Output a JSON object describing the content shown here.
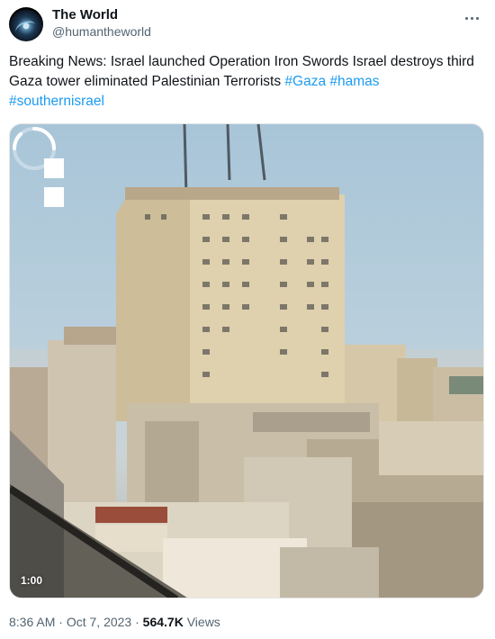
{
  "author": {
    "display_name": "The World",
    "handle": "@humantheworld",
    "avatar_icon": "globe-earth-avatar"
  },
  "tweet": {
    "text": "Breaking News: Israel launched Operation Iron Swords Israel destroys third Gaza tower eliminated Palestinian Terrorists ",
    "hashtags": [
      "#Gaza",
      "#hamas",
      "#southernisrael"
    ]
  },
  "media": {
    "type": "video",
    "timecode": "1:00",
    "overlay_icon": "loading-spinner-icon",
    "pause_icon": "pause-icon"
  },
  "meta": {
    "time": "8:36 AM",
    "separator": "·",
    "date": "Oct 7, 2023",
    "views_count": "564.7K",
    "views_label": "Views"
  },
  "colors": {
    "link": "#1d9bf0",
    "muted": "#536471",
    "text": "#0f1419"
  }
}
